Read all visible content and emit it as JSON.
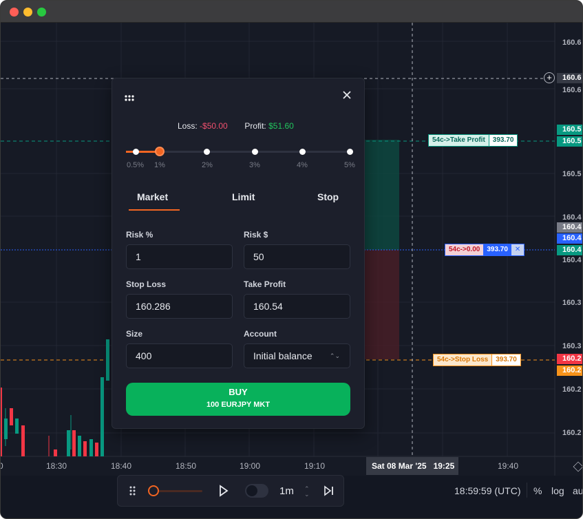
{
  "window": {
    "traffic_lights": [
      "#ff5f57",
      "#febc2e",
      "#28c840"
    ]
  },
  "y_axis": {
    "labels": [
      "160.6",
      "160.6",
      "160.5",
      "160.4",
      "160.4",
      "160.3",
      "160.3",
      "160.2",
      "160.2"
    ],
    "tags": [
      {
        "text": "160.5",
        "color": "#089981"
      },
      {
        "text": "160.5",
        "color": "#089981"
      },
      {
        "text": "160.4",
        "color": "#787b86"
      },
      {
        "text": "160.4",
        "color": "#2962ff"
      },
      {
        "text": "160.4",
        "color": "#089981"
      },
      {
        "text": "160.2",
        "color": "#f23645"
      },
      {
        "text": "160.2",
        "color": "#f7931a"
      }
    ],
    "crosshair_label": "160.6"
  },
  "x_axis": {
    "labels": [
      "0",
      "18:30",
      "18:40",
      "18:50",
      "19:00",
      "19:10",
      "19:40"
    ],
    "crosshair": "Sat 08 Mar '25   19:25"
  },
  "orders": {
    "take_profit": {
      "label": "54c->Take Profit",
      "value": "393.70"
    },
    "entry": {
      "label": "54c->0.00",
      "value": "393.70",
      "close": "✕"
    },
    "stop_loss": {
      "label": "54c->Stop Loss",
      "value": "393.70"
    }
  },
  "panel": {
    "loss_label": "Loss:",
    "loss_value": "-$50.00",
    "profit_label": "Profit:",
    "profit_value": "$51.60",
    "risk_steps": [
      "0.5%",
      "1%",
      "2%",
      "3%",
      "4%",
      "5%"
    ],
    "risk_selected_index": 1,
    "tabs": [
      "Market",
      "Limit",
      "Stop"
    ],
    "active_tab": "Market",
    "risk_pct": {
      "label": "Risk %",
      "value": "1"
    },
    "risk_usd": {
      "label": "Risk $",
      "value": "50"
    },
    "stop_loss": {
      "label": "Stop Loss",
      "value": "160.286"
    },
    "take_profit": {
      "label": "Take Profit",
      "value": "160.54"
    },
    "size": {
      "label": "Size",
      "value": "400"
    },
    "account": {
      "label": "Account",
      "value": "Initial balance"
    },
    "buy": {
      "line1": "BUY",
      "line2": "100 EURJPY MKT"
    }
  },
  "playback": {
    "interval": "1m"
  },
  "status": {
    "time": "18:59:59 (UTC)",
    "percent": "%",
    "log": "log",
    "auto": "au"
  },
  "colors": {
    "up": "#089981",
    "down": "#f23645",
    "accent": "#f26522",
    "buy": "#08b15b"
  }
}
